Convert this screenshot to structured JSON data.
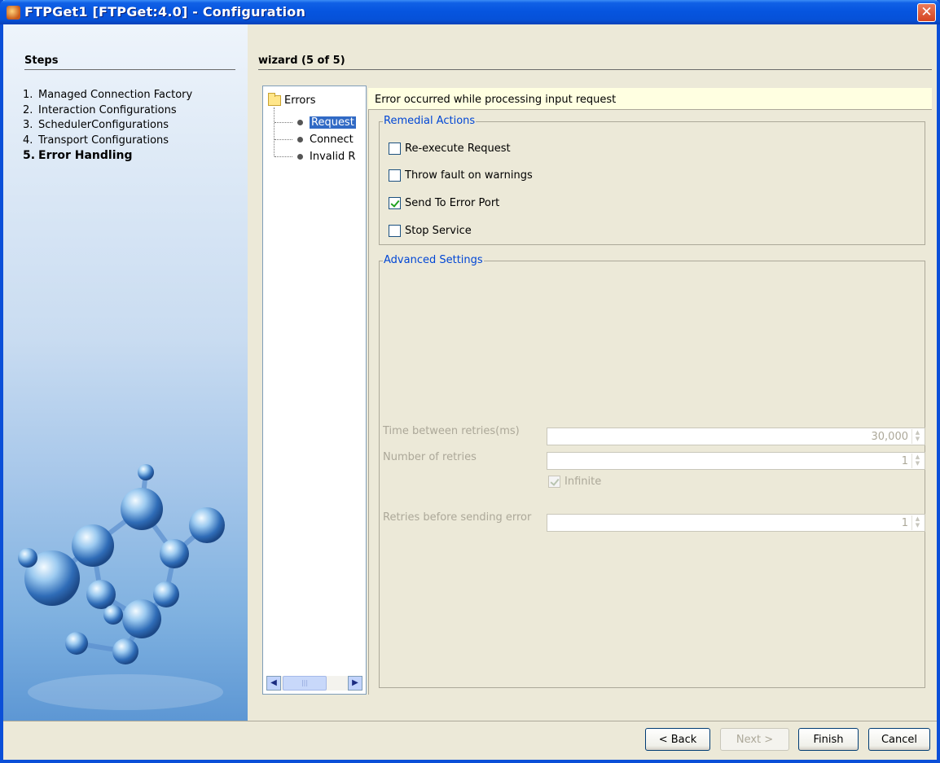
{
  "window": {
    "title": "FTPGet1 [FTPGet:4.0] - Configuration",
    "close_glyph": "✕"
  },
  "steps": {
    "header": "Steps",
    "items": [
      {
        "num": "1.",
        "label": "Managed Connection Factory"
      },
      {
        "num": "2.",
        "label": "Interaction Configurations"
      },
      {
        "num": "3.",
        "label": "SchedulerConfigurations"
      },
      {
        "num": "4.",
        "label": "Transport Configurations"
      },
      {
        "num": "5.",
        "label": "Error Handling"
      }
    ],
    "current_index": 4
  },
  "main": {
    "header": "wizard (5 of 5)",
    "tree": {
      "root": "Errors",
      "items": [
        "Request",
        "Connect",
        "Invalid R"
      ],
      "selected_index": 0
    },
    "info": "Error occurred while processing input request",
    "remedial": {
      "legend": "Remedial Actions",
      "options": [
        {
          "label": "Re-execute Request",
          "checked": false
        },
        {
          "label": "Throw fault on warnings",
          "checked": false
        },
        {
          "label": "Send To Error Port",
          "checked": true
        },
        {
          "label": "Stop Service",
          "checked": false
        }
      ]
    },
    "advanced": {
      "legend": "Advanced Settings",
      "time_label": "Time between retries(ms)",
      "time_value": "30,000",
      "retries_label": "Number of retries",
      "retries_value": "1",
      "infinite_label": "Infinite",
      "infinite_checked": true,
      "before_error_label": "Retries before sending error",
      "before_error_value": "1"
    }
  },
  "footer": {
    "back": "< Back",
    "next": "Next >",
    "finish": "Finish",
    "cancel": "Cancel"
  }
}
